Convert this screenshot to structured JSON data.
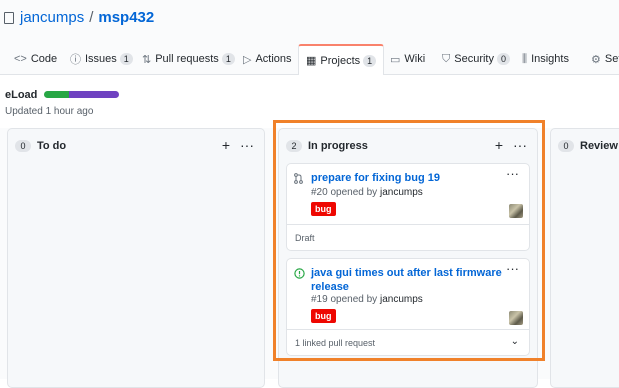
{
  "repo": {
    "owner": "jancumps",
    "separator": "/",
    "name": "msp432"
  },
  "tabs": [
    {
      "label": "Code",
      "icon": "code-icon",
      "glyph": "<>"
    },
    {
      "label": "Issues",
      "icon": "issue-icon",
      "glyph": "ⓘ",
      "count": "1"
    },
    {
      "label": "Pull requests",
      "icon": "pull-request-icon",
      "glyph": "⇅",
      "count": "1"
    },
    {
      "label": "Actions",
      "icon": "play-icon",
      "glyph": "▷"
    },
    {
      "label": "Projects",
      "icon": "project-icon",
      "glyph": "▦",
      "count": "1",
      "active": true
    },
    {
      "label": "Wiki",
      "icon": "book-icon",
      "glyph": "▭"
    },
    {
      "label": "Security",
      "icon": "shield-icon",
      "glyph": "⛉",
      "count": "0"
    },
    {
      "label": "Insights",
      "icon": "graph-icon",
      "glyph": "⫼"
    },
    {
      "label": "Set",
      "icon": "gear-icon",
      "glyph": "⚙"
    }
  ],
  "project": {
    "name": "eLoad",
    "updated": "Updated 1 hour ago",
    "progress": {
      "done": 0.33,
      "in_progress": 0.67
    }
  },
  "columns": [
    {
      "count": "0",
      "title": "To do",
      "add": "+",
      "more": "···"
    },
    {
      "count": "2",
      "title": "In progress",
      "add": "+",
      "more": "···",
      "cards": [
        {
          "icon": "pull-request-icon",
          "title": "prepare for fixing bug 19",
          "number": "#20",
          "opened_by": "opened by",
          "author": "jancumps",
          "label": "bug",
          "footer": "Draft",
          "more": "···"
        },
        {
          "icon": "issue-opened-icon",
          "title": "java gui times out after last firmware release",
          "number": "#19",
          "opened_by": "opened by",
          "author": "jancumps",
          "label": "bug",
          "footer": "1 linked pull request",
          "more": "···",
          "chevron": "⌄"
        }
      ]
    },
    {
      "count": "0",
      "title": "Review in"
    }
  ],
  "colors": {
    "accent": "#0366d6",
    "bug": "#ee0701",
    "highlight": "#f0812a",
    "done": "#28a745",
    "in_progress": "#6f42c1"
  }
}
